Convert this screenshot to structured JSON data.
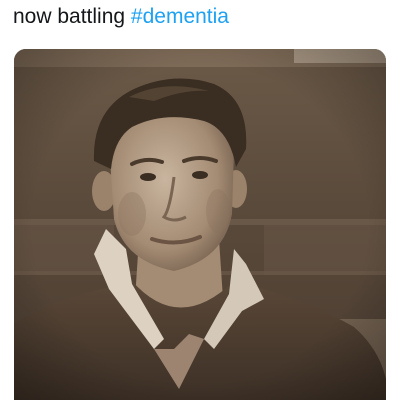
{
  "tweet": {
    "text_plain": "now battling ",
    "hashtag": "#dementia"
  },
  "photo": {
    "style": "sepia",
    "subject": "player-portrait"
  },
  "colors": {
    "text": "#14171a",
    "hashtag": "#1da1f2",
    "sepia_dark": "#3a2d22",
    "sepia_mid": "#7a6553",
    "sepia_light": "#d8ccbd"
  }
}
